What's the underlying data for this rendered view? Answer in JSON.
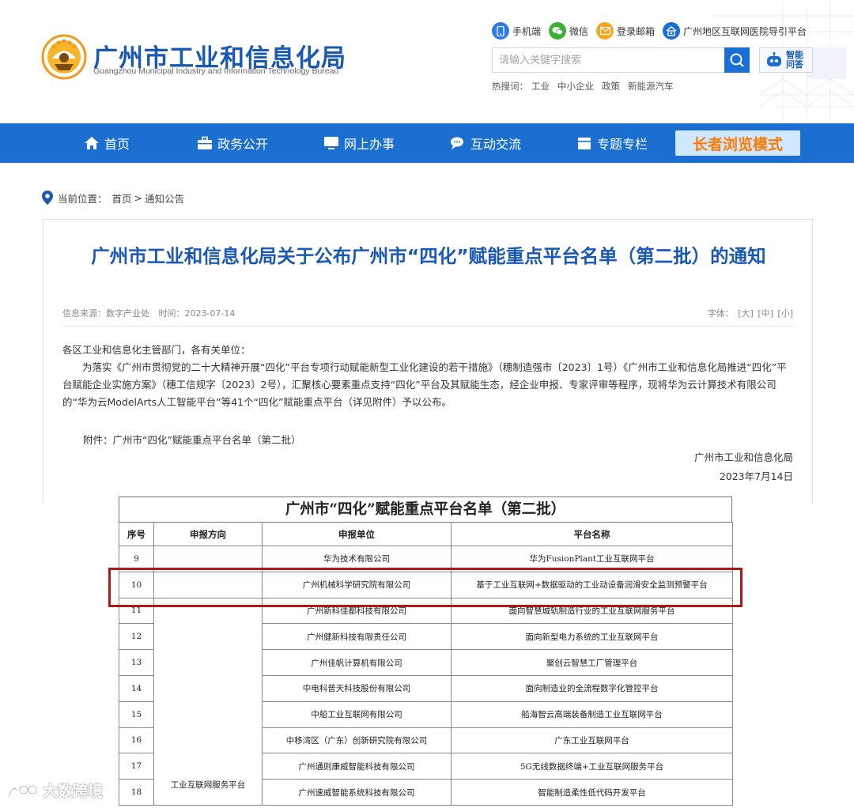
{
  "header": {
    "title": "广州市工业和信息化局",
    "subtitle": "Guangzhou Municipal Industry and Information Technology Bureau",
    "top_links": [
      "手机端",
      "微信",
      "登录邮箱",
      "广州地区互联网医院导引平台"
    ],
    "search_placeholder": "请输入关键字搜索",
    "ai_label": "智能问答",
    "hot_label": "热搜词：",
    "hot_words": [
      "工业",
      "中小企业",
      "政策",
      "新能源汽车"
    ]
  },
  "nav": {
    "items": [
      "首页",
      "政务公开",
      "网上办事",
      "互动交流",
      "专题专栏"
    ],
    "elder_mode": "长者浏览模式"
  },
  "breadcrumb": {
    "label": "当前位置：",
    "home": "首页",
    "sep": ">",
    "current": "通知公告"
  },
  "article": {
    "title": "广州市工业和信息化局关于公布广州市“四化”赋能重点平台名单（第二批）的通知",
    "source": "信息来源：数字产业处",
    "time": "时间：2023-07-14",
    "font_label": "字体：",
    "font_sizes": [
      "[大]",
      "[中]",
      "[小]"
    ],
    "salutation": "各区工业和信息化主管部门，各有关单位：",
    "paragraph": "为落实《广州市贯彻党的二十大精神开展“四化”平台专项行动赋能新型工业化建设的若干措施》（穗制造强市〔2023〕1号）《广州市工业和信息化局推进“四化”平台赋能企业实施方案》（穗工信规字〔2023〕2号），汇聚核心要素重点支持“四化”平台及其赋能生态，经企业申报、专家评审等程序，现将华为云计算技术有限公司的“华为云ModelArts人工智能平台”等41个“四化”赋能重点平台（详见附件）予以公布。",
    "attachment": "附件：广州市“四化”赋能重点平台名单（第二批）",
    "signer": "广州市工业和信息化局",
    "date": "2023年7月14日"
  },
  "table": {
    "caption": "广州市“四化”赋能重点平台名单（第二批）",
    "headers": [
      "序号",
      "申报方向",
      "申报单位",
      "平台名称"
    ],
    "direction_merged": "工业互联网服务平台",
    "rows": [
      {
        "no": "9",
        "unit": "华为技术有限公司",
        "platform": "华为FusionPlant工业互联网平台"
      },
      {
        "no": "10",
        "unit": "广州机械科学研究院有限公司",
        "platform": "基于工业互联网+数据驱动的工业动设备润滑安全监测预警平台"
      },
      {
        "no": "11",
        "unit": "广州新科佳都科技有限公司",
        "platform": "面向智慧城轨制造行业的工业互联网服务平台"
      },
      {
        "no": "12",
        "unit": "广州健新科技有限责任公司",
        "platform": "面向新型电力系统的工业互联网平台"
      },
      {
        "no": "13",
        "unit": "广州佳帆计算机有限公司",
        "platform": "聚创云智慧工厂管理平台"
      },
      {
        "no": "14",
        "unit": "中电科普天科技股份有限公司",
        "platform": "面向制造业的全流程数字化管控平台"
      },
      {
        "no": "15",
        "unit": "中船工业互联网有限公司",
        "platform": "船海智云高端装备制造工业互联网平台"
      },
      {
        "no": "16",
        "unit": "中移湾区（广东）创新研究院有限公司",
        "platform": "广东工业互联网平台"
      },
      {
        "no": "17",
        "unit": "广州通则康威智能科技有限公司",
        "platform": "5G无线数据终端+工业互联网服务平台"
      },
      {
        "no": "18",
        "unit": "广州速威智能系统科技有限公司",
        "platform": "智能制造柔性低代码开发平台"
      }
    ]
  },
  "watermark": "大数跨境",
  "colors": {
    "brand_blue": "#1a59b3",
    "nav_blue": "#1a6fd1",
    "elder_text": "#ff7a00",
    "highlight_red": "#b01717"
  }
}
